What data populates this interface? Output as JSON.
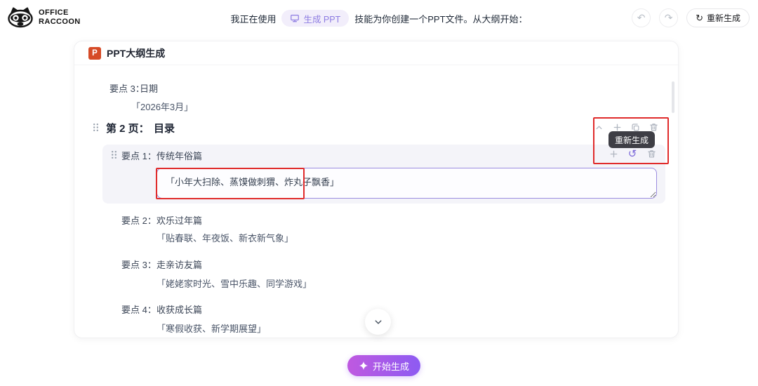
{
  "header": {
    "logo": {
      "line1": "OFFICE",
      "line2": "RACCOON"
    },
    "status": {
      "prefix": "我正在使用",
      "skill": "生成 PPT",
      "suffix": "技能为你创建一个PPT文件。从大纲开始："
    },
    "actions": {
      "regenerate": "重新生成"
    }
  },
  "icons": {
    "undo": "↶",
    "redo": "↷",
    "refresh": "↻",
    "row_refresh": "↺"
  },
  "card": {
    "title": "PPT大纲生成",
    "ppt_icon_letter": "P",
    "previous_item": {
      "label": "要点 3：",
      "title": "日期",
      "desc": "「2026年3月」"
    },
    "page_header": {
      "label": "第 2 页：",
      "title": "目录"
    },
    "tooltip": "重新生成",
    "points": [
      {
        "label": "要点 1：",
        "title": "传统年俗篇",
        "desc": "「小年大扫除、蒸馍做刺猬、炸丸子飘香」"
      },
      {
        "label": "要点 2：",
        "title": "欢乐过年篇",
        "desc": "「贴春联、年夜饭、新衣新气象」"
      },
      {
        "label": "要点 3：",
        "title": "走亲访友篇",
        "desc": "「姥姥家时光、雪中乐趣、同学游戏」"
      },
      {
        "label": "要点 4：",
        "title": "收获成长篇",
        "desc": "「寒假收获、新学期展望」"
      }
    ]
  },
  "footer": {
    "generate": "开始生成"
  },
  "colors": {
    "accent_purple": "#8d5bf2",
    "pill_bg": "#f2eefb",
    "pill_text": "#8d7ce2",
    "annotation_red": "#e02b2b",
    "tooltip_bg": "#3e3e45",
    "ppt_icon": "#d64b27",
    "gradient_start": "#bf59e0",
    "gradient_end": "#8d5bf2",
    "point_block_bg": "#f4f4f9",
    "input_border": "#9b8ce0"
  }
}
